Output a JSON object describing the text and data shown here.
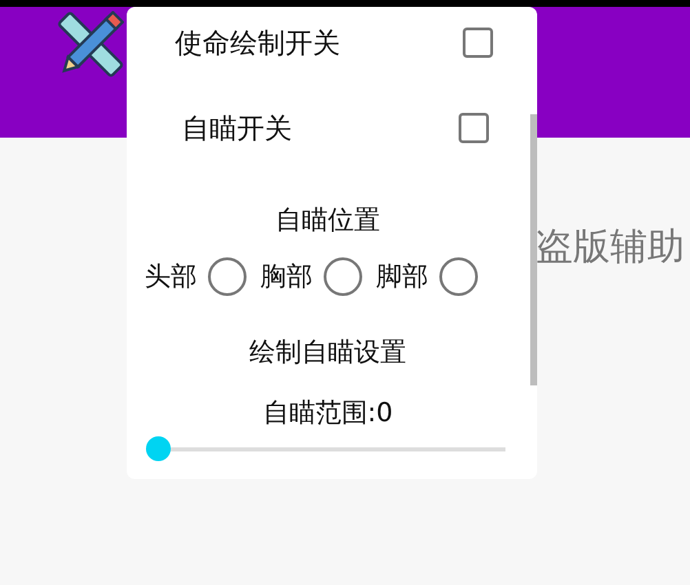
{
  "background_text": "盗版辅助",
  "dialog": {
    "switches": [
      {
        "label": "使命绘制开关",
        "checked": false
      },
      {
        "label": "自瞄开关",
        "checked": false
      }
    ],
    "aim_position": {
      "title": "自瞄位置",
      "options": [
        {
          "label": "头部",
          "selected": false
        },
        {
          "label": "胸部",
          "selected": false
        },
        {
          "label": "脚部",
          "selected": false
        }
      ]
    },
    "draw_title": "绘制自瞄设置",
    "range": {
      "label": "自瞄范围:0",
      "level": 0
    }
  }
}
